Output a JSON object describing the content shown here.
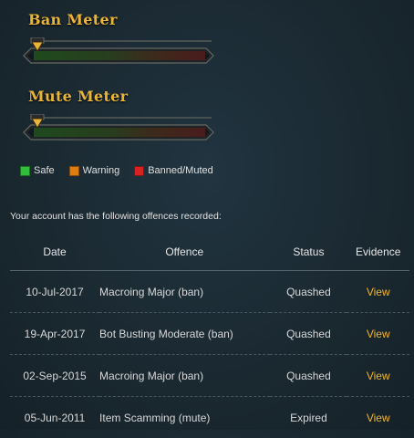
{
  "ban_meter": {
    "title": "Ban Meter",
    "level": 0
  },
  "mute_meter": {
    "title": "Mute Meter",
    "level": 0
  },
  "legend": [
    {
      "label": "Safe",
      "color": "#2fbf3a"
    },
    {
      "label": "Warning",
      "color": "#e07d12"
    },
    {
      "label": "Banned/Muted",
      "color": "#d62222"
    }
  ],
  "intro": "Your account has the following offences recorded:",
  "table": {
    "headers": {
      "date": "Date",
      "offence": "Offence",
      "status": "Status",
      "evidence": "Evidence"
    },
    "rows": [
      {
        "date": "10-Jul-2017",
        "offence": "Macroing Major (ban)",
        "status": "Quashed",
        "evidence": "View"
      },
      {
        "date": "19-Apr-2017",
        "offence": "Bot Busting Moderate (ban)",
        "status": "Quashed",
        "evidence": "View"
      },
      {
        "date": "02-Sep-2015",
        "offence": "Macroing Major (ban)",
        "status": "Quashed",
        "evidence": "View"
      },
      {
        "date": "05-Jun-2011",
        "offence": "Item Scamming (mute)",
        "status": "Expired",
        "evidence": "View"
      }
    ]
  }
}
